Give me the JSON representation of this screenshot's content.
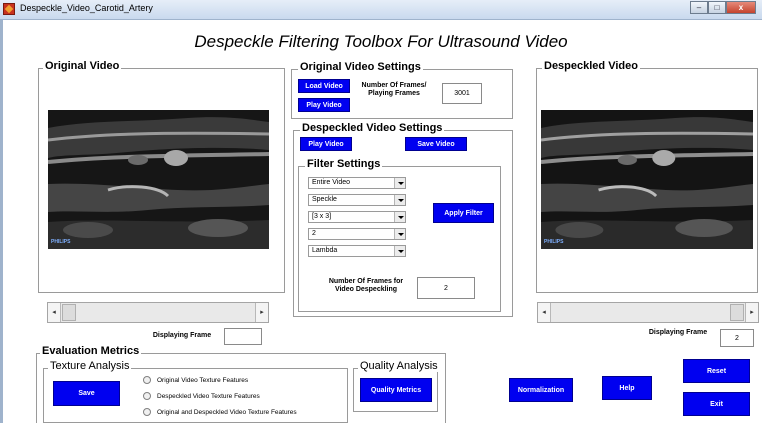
{
  "window": {
    "title": "Despeckle_Video_Carotid_Artery",
    "controls": {
      "minimize": "–",
      "maximize": "□",
      "close": "x"
    }
  },
  "main_title": "Despeckle Filtering Toolbox For Ultrasound Video",
  "original_video": {
    "title": "Original Video",
    "vendor_tag": "PHILIPS",
    "displaying_frame_label": "Displaying Frame",
    "displaying_frame_value": ""
  },
  "original_settings": {
    "title": "Original Video Settings",
    "load_button": "Load Video",
    "play_button": "Play Video",
    "frames_label": "Number Of Frames/ Playing Frames",
    "frames_value": "3001"
  },
  "despeckled_settings": {
    "title": "Despeckled Video Settings",
    "play_button": "Play Video",
    "save_button": "Save Video",
    "filter_settings": {
      "title": "Filter Settings",
      "selects": [
        "Entire Video",
        "Speckle",
        "[3 x 3]",
        "2",
        "Lambda"
      ],
      "apply_button": "Apply Filter",
      "frames_label": "Number Of Frames for Video Despeckling",
      "frames_value": "2"
    }
  },
  "despeckled_video": {
    "title": "Despeckled Video",
    "vendor_tag": "PHILIPS",
    "displaying_frame_label": "Displaying Frame",
    "displaying_frame_value": "2"
  },
  "evaluation": {
    "title": "Evaluation Metrics",
    "texture": {
      "title": "Texture Analysis",
      "save_button": "Save",
      "options": [
        "Original Video Texture Features",
        "Despeckled Video Texture Features",
        "Original and Despeckled Video Texture Features"
      ]
    },
    "quality": {
      "title": "Quality Analysis",
      "button": "Quality Metrics"
    }
  },
  "actions": {
    "normalization": "Normalization",
    "help": "Help",
    "reset": "Reset",
    "exit": "Exit"
  },
  "colors": {
    "button_blue": "#0000f0",
    "frame_border": "#9a9a9a"
  }
}
